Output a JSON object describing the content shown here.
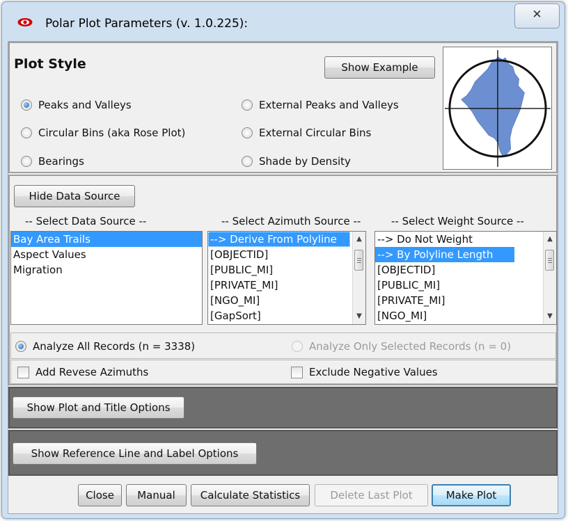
{
  "window": {
    "title": "Polar Plot Parameters (v. 1.0.225):",
    "close_glyph": "✕"
  },
  "plot_style": {
    "heading": "Plot Style",
    "show_example_label": "Show Example",
    "options": [
      {
        "label": "Peaks and Valleys",
        "selected": true
      },
      {
        "label": "External Peaks and Valleys",
        "selected": false
      },
      {
        "label": "Circular Bins (aka Rose Plot)",
        "selected": false
      },
      {
        "label": "External Circular Bins",
        "selected": false
      },
      {
        "label": "Bearings",
        "selected": false
      },
      {
        "label": "Shade by Density",
        "selected": false
      }
    ],
    "preview_fill_color": "#6b8fd0"
  },
  "data_source": {
    "hide_button_label": "Hide Data Source",
    "data_source_label": "-- Select Data Source --",
    "data_sources": [
      "Bay Area Trails",
      "Aspect Values",
      "Migration"
    ],
    "selected_data_source": "Bay Area Trails",
    "azimuth_label": "-- Select Azimuth Source --",
    "azimuth_sources": [
      "--> Derive From Polyline",
      "[OBJECTID]",
      "[PUBLIC_MI]",
      "[PRIVATE_MI]",
      "[NGO_MI]",
      "[GapSort]"
    ],
    "selected_azimuth_source": "--> Derive From Polyline",
    "weight_label": "-- Select Weight Source --",
    "weight_sources": [
      "--> Do Not Weight",
      "--> By Polyline Length",
      "[OBJECTID]",
      "[PUBLIC_MI]",
      "[PRIVATE_MI]",
      "[NGO_MI]"
    ],
    "selected_weight_source": "--> By Polyline Length",
    "selection_color": "#3399ff"
  },
  "records": {
    "analyze_all_label": "Analyze All Records (n = 3338)",
    "analyze_all_selected": true,
    "analyze_selected_label": "Analyze Only Selected Records (n = 0)",
    "analyze_selected_enabled": false
  },
  "options": {
    "add_reverse_label": "Add Revese Azimuths",
    "add_reverse_checked": false,
    "exclude_negative_label": "Exclude Negative Values",
    "exclude_negative_checked": false
  },
  "sections": {
    "plot_title_options_label": "Show Plot and Title Options",
    "reference_line_options_label": "Show Reference Line and Label Options"
  },
  "footer": {
    "close_label": "Close",
    "manual_label": "Manual",
    "calculate_label": "Calculate Statistics",
    "delete_label": "Delete Last Plot",
    "make_plot_label": "Make Plot"
  }
}
